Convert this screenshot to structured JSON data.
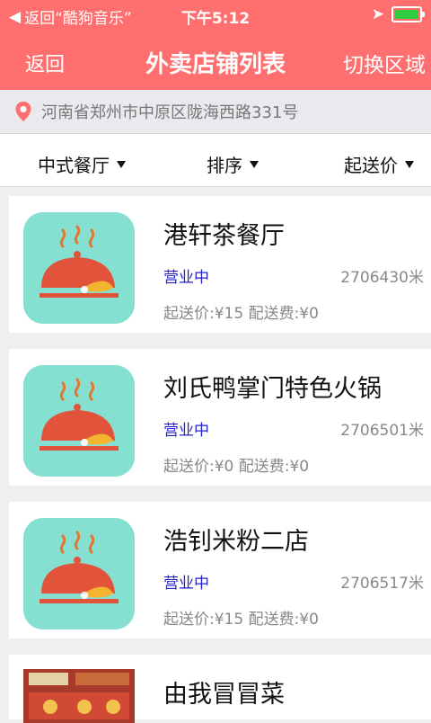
{
  "status_bar": {
    "back_app": "返回“酷狗音乐”",
    "time": "下午5:12"
  },
  "navbar": {
    "back": "返回",
    "title": "外卖店铺列表",
    "switch_area": "切换区域"
  },
  "address": {
    "text": "河南省郑州市中原区陇海西路331号"
  },
  "filters": [
    {
      "label": "中式餐厅"
    },
    {
      "label": "排序"
    },
    {
      "label": "起送价"
    }
  ],
  "stores": [
    {
      "name": "港轩茶餐厅",
      "status": "营业中",
      "distance": "2706430米",
      "fee": "起送价:¥15 配送费:¥0"
    },
    {
      "name": "刘氏鸭掌门特色火锅",
      "status": "营业中",
      "distance": "2706501米",
      "fee": "起送价:¥0  配送费:¥0"
    },
    {
      "name": "浩钊米粉二店",
      "status": "营业中",
      "distance": "2706517米",
      "fee": "起送价:¥15 配送费:¥0"
    },
    {
      "name": "由我冒冒菜"
    }
  ],
  "colors": {
    "accent": "#ff6f6f",
    "status_text": "#2222cc",
    "thumb_bg": "#86e0d1"
  }
}
